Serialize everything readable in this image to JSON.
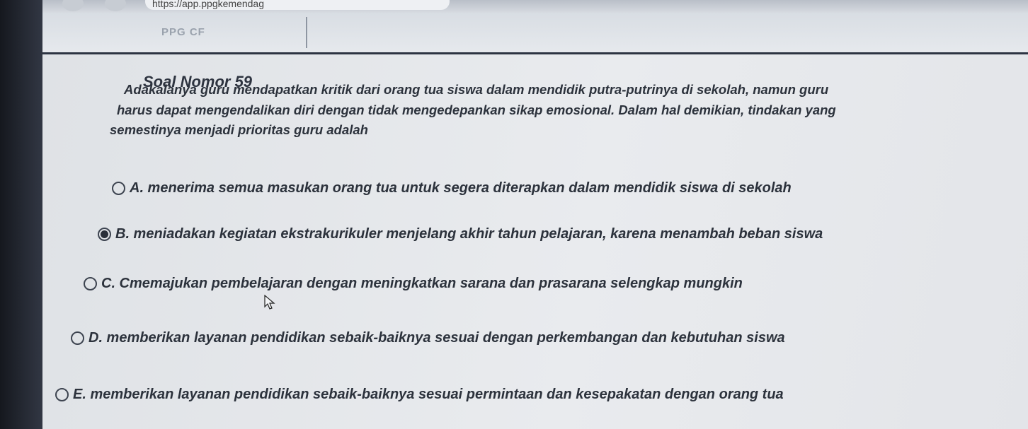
{
  "browser": {
    "url": "https://app.ppgkemendag"
  },
  "header": {
    "logo_text": "PPG CF"
  },
  "question": {
    "number_label": "Soal Nomor 59",
    "lines": [
      "Adakalanya guru mendapatkan kritik dari orang tua siswa dalam mendidik putra-putrinya di sekolah, namun guru",
      "harus dapat mengendalikan diri dengan tidak mengedepankan sikap emosional. Dalam hal demikian, tindakan yang",
      "semestinya menjadi prioritas guru adalah"
    ]
  },
  "options": [
    {
      "label": "A. menerima semua masukan orang tua untuk segera diterapkan dalam mendidik siswa di sekolah",
      "selected": false
    },
    {
      "label": "B. meniadakan kegiatan ekstrakurikuler menjelang akhir tahun pelajaran, karena menambah beban siswa",
      "selected": true
    },
    {
      "label": "C. Cmemajukan pembelajaran dengan meningkatkan sarana dan prasarana selengkap mungkin",
      "selected": false
    },
    {
      "label": "D. memberikan layanan pendidikan sebaik-baiknya sesuai dengan perkembangan dan kebutuhan siswa",
      "selected": false
    },
    {
      "label": "E. memberikan layanan pendidikan sebaik-baiknya sesuai permintaan dan kesepakatan dengan orang tua",
      "selected": false
    }
  ]
}
